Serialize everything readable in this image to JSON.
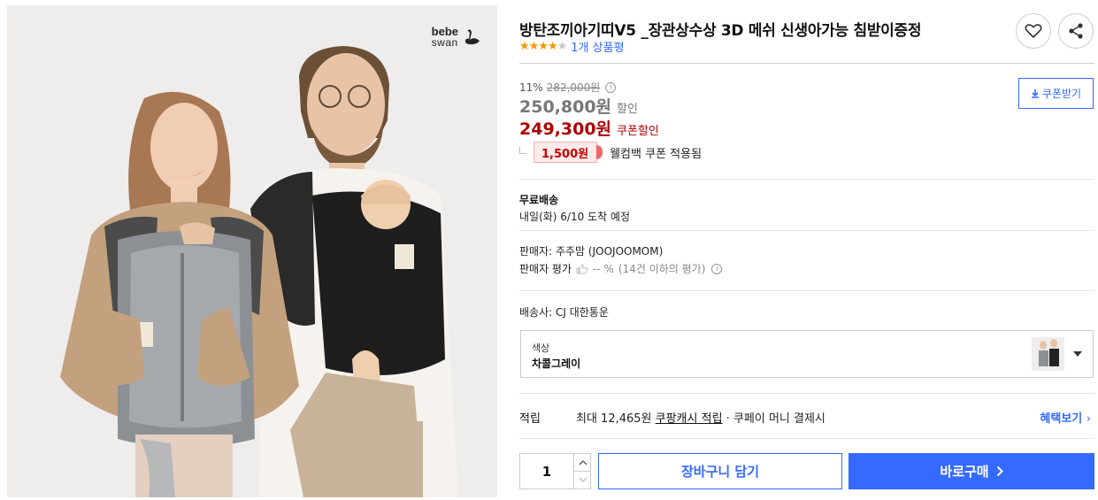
{
  "brand": {
    "line1": "bebe",
    "line2": "swan",
    "logo_icon": "swan-icon"
  },
  "product": {
    "title": "방탄조끼아기띠V5 _장관상수상 3D 메쉬 신생아가능 침받이증정",
    "rating_stars": 4,
    "rating_max": 5,
    "review_text": "1개 상품평"
  },
  "actions": {
    "wishlist_icon": "heart-icon",
    "share_icon": "share-icon"
  },
  "price": {
    "discount_rate": "11%",
    "original": "282,000원",
    "sale": "250,800원",
    "sale_label": "할인",
    "coupon": "249,300원",
    "coupon_label": "쿠폰할인",
    "coupon_button": "쿠폰받기",
    "welcome_amount": "1,500원",
    "welcome_text": "웰컴백 쿠폰 적용됨"
  },
  "shipping": {
    "label": "무료배송",
    "date_text": "내일(화) 6/10 도착 예정"
  },
  "seller": {
    "name_text": "판매자: 주주맘 (JOOJOOMOM)",
    "rating_label": "판매자 평가",
    "rating_value": "-- %",
    "rating_note": "(14건 이하의 평가)",
    "courier_text": "배송사: CJ 대한통운"
  },
  "option": {
    "label": "색상",
    "value": "차콜그레이"
  },
  "reward": {
    "label": "적립",
    "text_prefix": "최대 12,465원 ",
    "text_link": "쿠팡캐시 적립",
    "text_suffix": " · 쿠페이 머니 결제시",
    "benefit_link": "혜택보기"
  },
  "purchase": {
    "quantity": "1",
    "cart_label": "장바구니 담기",
    "buy_label": "바로구매"
  },
  "colors": {
    "accent_blue": "#346aff",
    "coupon_red": "#ae0000",
    "star_orange": "#f39800"
  }
}
